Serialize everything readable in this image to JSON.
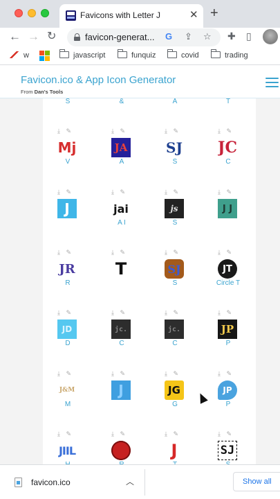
{
  "browser": {
    "tab_title": "Favicons with Letter J",
    "url": "favicon-generat...",
    "bookmarks": [
      "w",
      "javascript",
      "funquiz",
      "covid",
      "trading"
    ]
  },
  "site": {
    "title": "Favicon.ico & App Icon Generator",
    "subtitle_prefix": "From",
    "subtitle_brand": "Dan's Tools"
  },
  "grid": {
    "top_row_labels": [
      "S",
      "&",
      "A",
      "T"
    ],
    "icons": [
      {
        "letter": "Mj",
        "label": "V"
      },
      {
        "letter": "JA",
        "label": "A"
      },
      {
        "letter": "SJ",
        "label": "S"
      },
      {
        "letter": "JC",
        "label": "C"
      },
      {
        "letter": "J",
        "label": ""
      },
      {
        "letter": "jai",
        "label": "A I"
      },
      {
        "letter": "js",
        "label": "S"
      },
      {
        "letter": "J J",
        "label": ""
      },
      {
        "letter": "JR",
        "label": "R"
      },
      {
        "letter": "T",
        "label": ""
      },
      {
        "letter": "SJ",
        "label": "S"
      },
      {
        "letter": "JT",
        "label": "Circle T"
      },
      {
        "letter": "JD",
        "label": "D"
      },
      {
        "letter": "jc.",
        "label": "C"
      },
      {
        "letter": "jc.",
        "label": "C"
      },
      {
        "letter": "JP",
        "label": "P"
      },
      {
        "letter": "J&M",
        "label": "M"
      },
      {
        "letter": "J",
        "label": ""
      },
      {
        "letter": "JG",
        "label": "G"
      },
      {
        "letter": "JP",
        "label": "P"
      },
      {
        "letter": "JIIL",
        "label": "H"
      },
      {
        "letter": "",
        "label": "R"
      },
      {
        "letter": "J",
        "label": "T"
      },
      {
        "letter": "SJ",
        "label": "S"
      }
    ]
  },
  "downloads": {
    "file_name": "favicon.ico",
    "show_all": "Show all"
  }
}
